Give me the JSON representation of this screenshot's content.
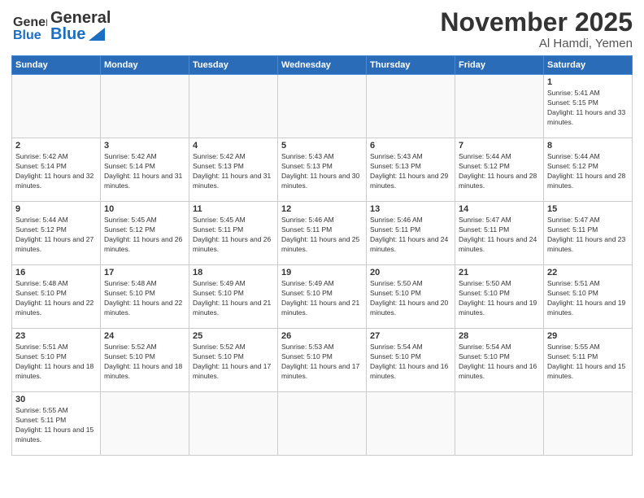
{
  "header": {
    "logo_general": "General",
    "logo_blue": "Blue",
    "month_title": "November 2025",
    "location": "Al Hamdi, Yemen"
  },
  "days": [
    "Sunday",
    "Monday",
    "Tuesday",
    "Wednesday",
    "Thursday",
    "Friday",
    "Saturday"
  ],
  "cells": [
    [
      {
        "date": "",
        "sunrise": "",
        "sunset": "",
        "daylight": "",
        "empty": true
      },
      {
        "date": "",
        "sunrise": "",
        "sunset": "",
        "daylight": "",
        "empty": true
      },
      {
        "date": "",
        "sunrise": "",
        "sunset": "",
        "daylight": "",
        "empty": true
      },
      {
        "date": "",
        "sunrise": "",
        "sunset": "",
        "daylight": "",
        "empty": true
      },
      {
        "date": "",
        "sunrise": "",
        "sunset": "",
        "daylight": "",
        "empty": true
      },
      {
        "date": "",
        "sunrise": "",
        "sunset": "",
        "daylight": "",
        "empty": true
      },
      {
        "date": "1",
        "sunrise": "Sunrise: 5:41 AM",
        "sunset": "Sunset: 5:15 PM",
        "daylight": "Daylight: 11 hours and 33 minutes.",
        "empty": false
      }
    ],
    [
      {
        "date": "2",
        "sunrise": "Sunrise: 5:42 AM",
        "sunset": "Sunset: 5:14 PM",
        "daylight": "Daylight: 11 hours and 32 minutes.",
        "empty": false
      },
      {
        "date": "3",
        "sunrise": "Sunrise: 5:42 AM",
        "sunset": "Sunset: 5:14 PM",
        "daylight": "Daylight: 11 hours and 31 minutes.",
        "empty": false
      },
      {
        "date": "4",
        "sunrise": "Sunrise: 5:42 AM",
        "sunset": "Sunset: 5:13 PM",
        "daylight": "Daylight: 11 hours and 31 minutes.",
        "empty": false
      },
      {
        "date": "5",
        "sunrise": "Sunrise: 5:43 AM",
        "sunset": "Sunset: 5:13 PM",
        "daylight": "Daylight: 11 hours and 30 minutes.",
        "empty": false
      },
      {
        "date": "6",
        "sunrise": "Sunrise: 5:43 AM",
        "sunset": "Sunset: 5:13 PM",
        "daylight": "Daylight: 11 hours and 29 minutes.",
        "empty": false
      },
      {
        "date": "7",
        "sunrise": "Sunrise: 5:44 AM",
        "sunset": "Sunset: 5:12 PM",
        "daylight": "Daylight: 11 hours and 28 minutes.",
        "empty": false
      },
      {
        "date": "8",
        "sunrise": "Sunrise: 5:44 AM",
        "sunset": "Sunset: 5:12 PM",
        "daylight": "Daylight: 11 hours and 28 minutes.",
        "empty": false
      }
    ],
    [
      {
        "date": "9",
        "sunrise": "Sunrise: 5:44 AM",
        "sunset": "Sunset: 5:12 PM",
        "daylight": "Daylight: 11 hours and 27 minutes.",
        "empty": false
      },
      {
        "date": "10",
        "sunrise": "Sunrise: 5:45 AM",
        "sunset": "Sunset: 5:12 PM",
        "daylight": "Daylight: 11 hours and 26 minutes.",
        "empty": false
      },
      {
        "date": "11",
        "sunrise": "Sunrise: 5:45 AM",
        "sunset": "Sunset: 5:11 PM",
        "daylight": "Daylight: 11 hours and 26 minutes.",
        "empty": false
      },
      {
        "date": "12",
        "sunrise": "Sunrise: 5:46 AM",
        "sunset": "Sunset: 5:11 PM",
        "daylight": "Daylight: 11 hours and 25 minutes.",
        "empty": false
      },
      {
        "date": "13",
        "sunrise": "Sunrise: 5:46 AM",
        "sunset": "Sunset: 5:11 PM",
        "daylight": "Daylight: 11 hours and 24 minutes.",
        "empty": false
      },
      {
        "date": "14",
        "sunrise": "Sunrise: 5:47 AM",
        "sunset": "Sunset: 5:11 PM",
        "daylight": "Daylight: 11 hours and 24 minutes.",
        "empty": false
      },
      {
        "date": "15",
        "sunrise": "Sunrise: 5:47 AM",
        "sunset": "Sunset: 5:11 PM",
        "daylight": "Daylight: 11 hours and 23 minutes.",
        "empty": false
      }
    ],
    [
      {
        "date": "16",
        "sunrise": "Sunrise: 5:48 AM",
        "sunset": "Sunset: 5:10 PM",
        "daylight": "Daylight: 11 hours and 22 minutes.",
        "empty": false
      },
      {
        "date": "17",
        "sunrise": "Sunrise: 5:48 AM",
        "sunset": "Sunset: 5:10 PM",
        "daylight": "Daylight: 11 hours and 22 minutes.",
        "empty": false
      },
      {
        "date": "18",
        "sunrise": "Sunrise: 5:49 AM",
        "sunset": "Sunset: 5:10 PM",
        "daylight": "Daylight: 11 hours and 21 minutes.",
        "empty": false
      },
      {
        "date": "19",
        "sunrise": "Sunrise: 5:49 AM",
        "sunset": "Sunset: 5:10 PM",
        "daylight": "Daylight: 11 hours and 21 minutes.",
        "empty": false
      },
      {
        "date": "20",
        "sunrise": "Sunrise: 5:50 AM",
        "sunset": "Sunset: 5:10 PM",
        "daylight": "Daylight: 11 hours and 20 minutes.",
        "empty": false
      },
      {
        "date": "21",
        "sunrise": "Sunrise: 5:50 AM",
        "sunset": "Sunset: 5:10 PM",
        "daylight": "Daylight: 11 hours and 19 minutes.",
        "empty": false
      },
      {
        "date": "22",
        "sunrise": "Sunrise: 5:51 AM",
        "sunset": "Sunset: 5:10 PM",
        "daylight": "Daylight: 11 hours and 19 minutes.",
        "empty": false
      }
    ],
    [
      {
        "date": "23",
        "sunrise": "Sunrise: 5:51 AM",
        "sunset": "Sunset: 5:10 PM",
        "daylight": "Daylight: 11 hours and 18 minutes.",
        "empty": false
      },
      {
        "date": "24",
        "sunrise": "Sunrise: 5:52 AM",
        "sunset": "Sunset: 5:10 PM",
        "daylight": "Daylight: 11 hours and 18 minutes.",
        "empty": false
      },
      {
        "date": "25",
        "sunrise": "Sunrise: 5:52 AM",
        "sunset": "Sunset: 5:10 PM",
        "daylight": "Daylight: 11 hours and 17 minutes.",
        "empty": false
      },
      {
        "date": "26",
        "sunrise": "Sunrise: 5:53 AM",
        "sunset": "Sunset: 5:10 PM",
        "daylight": "Daylight: 11 hours and 17 minutes.",
        "empty": false
      },
      {
        "date": "27",
        "sunrise": "Sunrise: 5:54 AM",
        "sunset": "Sunset: 5:10 PM",
        "daylight": "Daylight: 11 hours and 16 minutes.",
        "empty": false
      },
      {
        "date": "28",
        "sunrise": "Sunrise: 5:54 AM",
        "sunset": "Sunset: 5:10 PM",
        "daylight": "Daylight: 11 hours and 16 minutes.",
        "empty": false
      },
      {
        "date": "29",
        "sunrise": "Sunrise: 5:55 AM",
        "sunset": "Sunset: 5:11 PM",
        "daylight": "Daylight: 11 hours and 15 minutes.",
        "empty": false
      }
    ],
    [
      {
        "date": "30",
        "sunrise": "Sunrise: 5:55 AM",
        "sunset": "Sunset: 5:11 PM",
        "daylight": "Daylight: 11 hours and 15 minutes.",
        "empty": false
      },
      {
        "date": "",
        "sunrise": "",
        "sunset": "",
        "daylight": "",
        "empty": true
      },
      {
        "date": "",
        "sunrise": "",
        "sunset": "",
        "daylight": "",
        "empty": true
      },
      {
        "date": "",
        "sunrise": "",
        "sunset": "",
        "daylight": "",
        "empty": true
      },
      {
        "date": "",
        "sunrise": "",
        "sunset": "",
        "daylight": "",
        "empty": true
      },
      {
        "date": "",
        "sunrise": "",
        "sunset": "",
        "daylight": "",
        "empty": true
      },
      {
        "date": "",
        "sunrise": "",
        "sunset": "",
        "daylight": "",
        "empty": true
      }
    ]
  ]
}
